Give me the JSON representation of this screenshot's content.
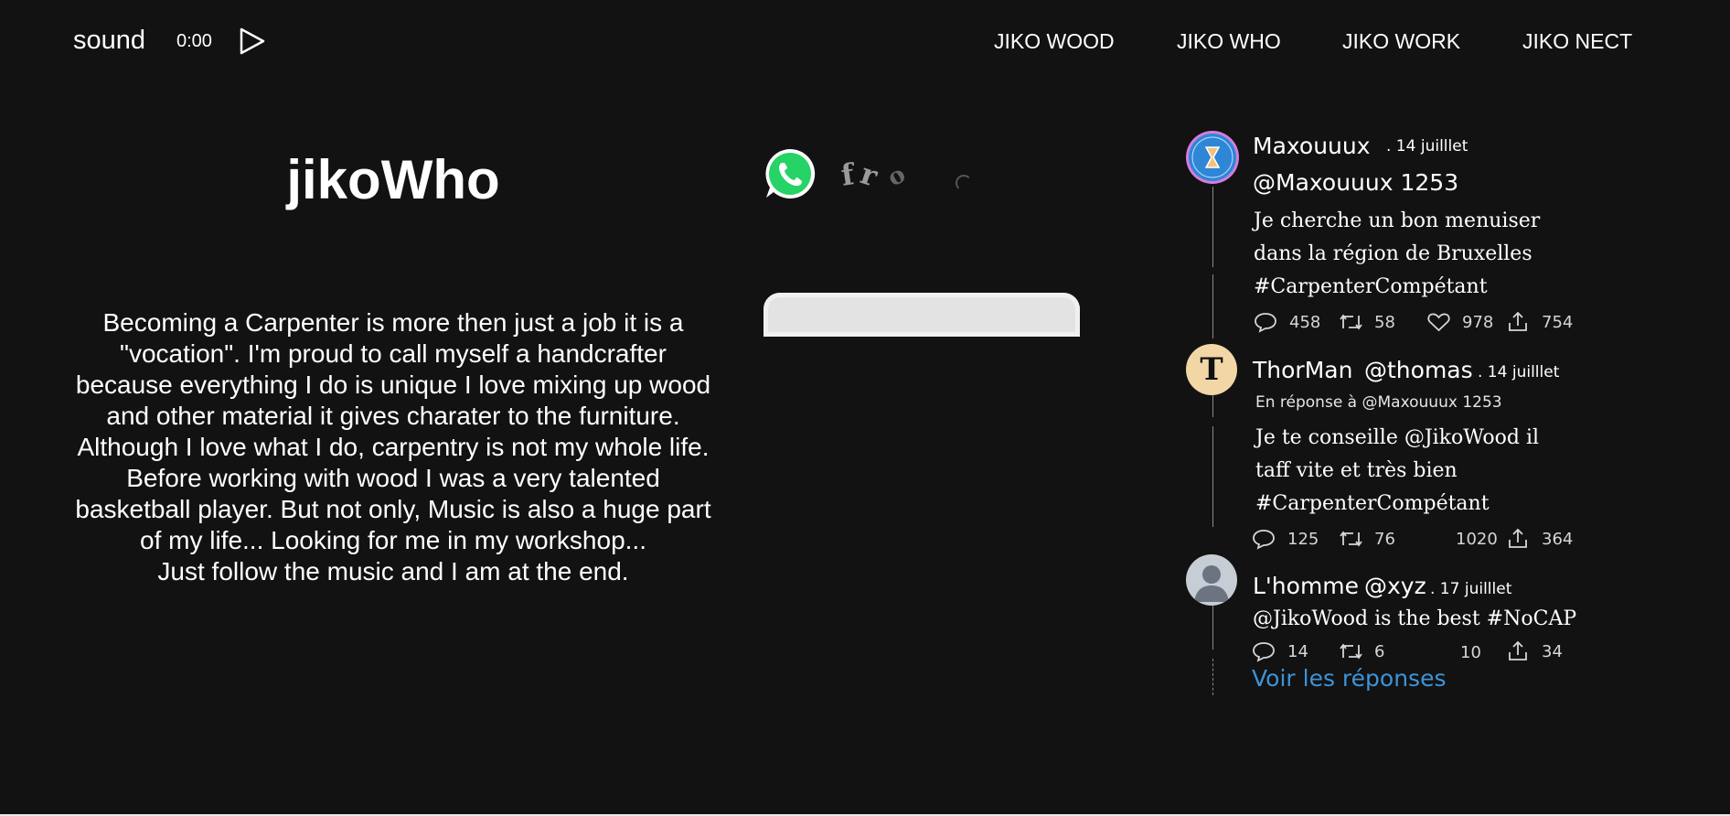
{
  "header": {
    "sound_label": "sound",
    "time": "0:00",
    "play_icon": "play-icon",
    "nav": [
      "JIKO WOOD",
      "JIKO WHO",
      "JIKO WORK",
      "JIKO NECT"
    ]
  },
  "main": {
    "title": "jikoWho",
    "bio": "Becoming a Carpenter is more then just a job it is a \"vocation\". I'm proud to call myself a handcrafter because everything I do is unique I love mixing up wood and other material it gives charater to the furniture. Although I love what I do, carpentry is not my whole life. Before working with wood I was a very talented basketball player. But not only, Music is also a huge part of my life... Looking for me in my workshop...",
    "bio_end": "Just follow the music and I am at the end."
  },
  "middle": {
    "whatsapp_icon": "whatsapp-icon",
    "scramble": [
      "f",
      "r",
      "o",
      "c"
    ]
  },
  "tweets": [
    {
      "name": "Maxouuux",
      "date": ". 14 juilllet",
      "handle": "@Maxouuux 1253",
      "text": [
        "Je cherche un bon menuiser",
        "dans la région de Bruxelles",
        "#CarpenterCompétant"
      ],
      "replies": "458",
      "retweets": "58",
      "likes": "978",
      "shares": "754"
    },
    {
      "name": "ThorMan",
      "handle": "@thomas",
      "date": ". 14 juilllet",
      "avatar_letter": "T",
      "reply_to": "En réponse à @Maxouuux 1253",
      "text": [
        "Je te conseille @JikoWood il",
        "taff vite et très bien",
        "#CarpenterCompétant"
      ],
      "replies": "125",
      "retweets": "76",
      "likes": "1020",
      "shares": "364"
    },
    {
      "name": "L'homme",
      "handle": "@xyz",
      "date": ". 17 juilllet",
      "text": [
        "@JikoWood is the best #NoCAP"
      ],
      "replies": "14",
      "retweets": "6",
      "likes": "10",
      "shares": "34"
    }
  ],
  "voir_label": "Voir les réponses",
  "colors": {
    "background": "#121212",
    "link": "#3d93d8",
    "whatsapp": "#25D366",
    "avatar_ring": "#c97fd3"
  }
}
